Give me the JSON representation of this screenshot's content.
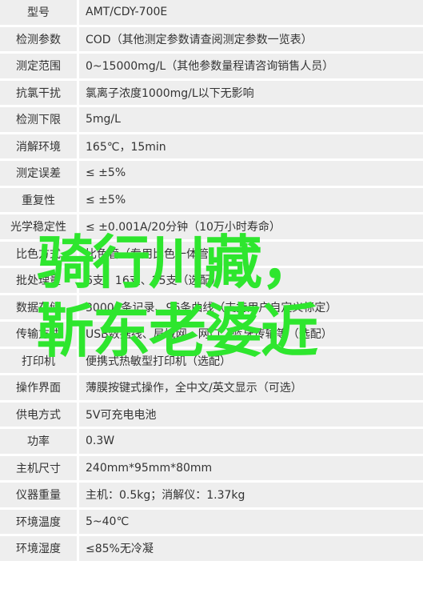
{
  "rows": [
    {
      "label": "型号",
      "value": "AMT/CDY-700E"
    },
    {
      "label": "检测参数",
      "value": "COD（其他测定参数请查阅测定参数一览表）"
    },
    {
      "label": "测定范围",
      "value": "0~15000mg/L（其他参数量程请咨询销售人员）"
    },
    {
      "label": "抗氯干扰",
      "value": "氯离子浓度1000mg/L以下无影响"
    },
    {
      "label": "检测下限",
      "value": "5mg/L"
    },
    {
      "label": "消解环境",
      "value": "165℃，15min"
    },
    {
      "label": "测定误差",
      "value": "≤ ±5%"
    },
    {
      "label": "重复性",
      "value": "≤ ±5%"
    },
    {
      "label": "光学稳定性",
      "value": "≤ ±0.001A/20分钟（10万小时寿命）"
    },
    {
      "label": "比色方式",
      "value": "比色管（专用比色一体管）"
    },
    {
      "label": "批处理量",
      "value": "6支、16支、25支（选配）"
    },
    {
      "label": "数据存储",
      "value": "30000条记录、96条曲线（支持用户自定义标定）"
    },
    {
      "label": "传输方式",
      "value": "USB数据线、局域网、网口、蓝牙传输等（选配）"
    },
    {
      "label": "打印机",
      "value": "便携式热敏型打印机（选配）"
    },
    {
      "label": "操作界面",
      "value": "薄膜按键式操作，全中文/英文显示（可选）"
    },
    {
      "label": "供电方式",
      "value": "5V可充电电池"
    },
    {
      "label": "功率",
      "value": "0.3W"
    },
    {
      "label": "主机尺寸",
      "value": "240mm*95mm*80mm"
    },
    {
      "label": "仪器重量",
      "value": "主机：0.5kg；消解仪：1.37kg"
    },
    {
      "label": "环境温度",
      "value": "5~40℃"
    },
    {
      "label": "环境湿度",
      "value": "≤85%无冷凝"
    }
  ],
  "overlay": {
    "line1": "骑行川藏，",
    "line2": "靳东老婆近",
    "color": "#2ee62e"
  }
}
